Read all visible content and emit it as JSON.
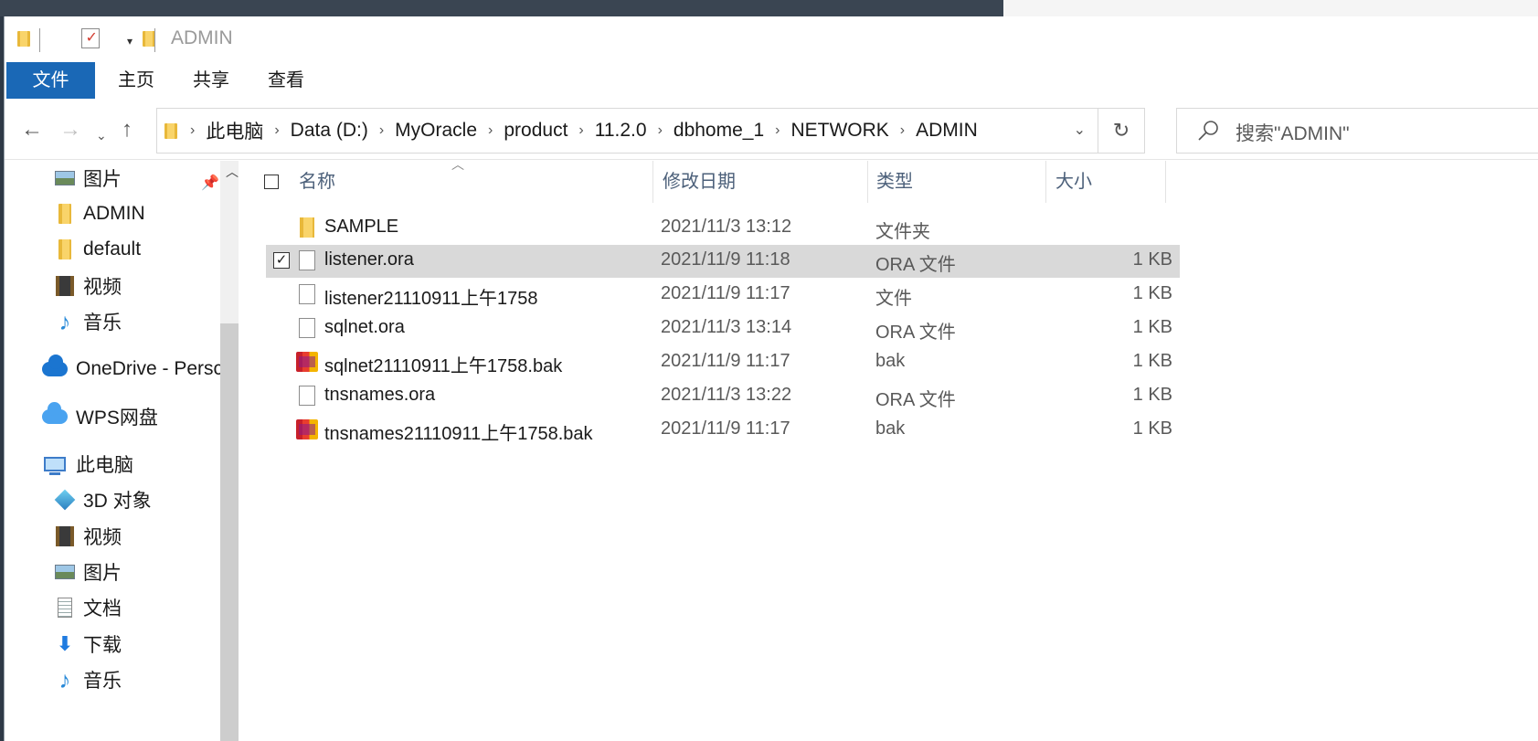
{
  "window": {
    "title": "ADMIN",
    "ribbon_tabs": [
      "文件",
      "主页",
      "共享",
      "查看"
    ]
  },
  "address": {
    "crumbs": [
      "此电脑",
      "Data (D:)",
      "MyOracle",
      "product",
      "11.2.0",
      "dbhome_1",
      "NETWORK",
      "ADMIN"
    ],
    "search_placeholder": "搜索\"ADMIN\""
  },
  "nav": {
    "items": [
      {
        "label": "图片",
        "icon": "picture-icon"
      },
      {
        "label": "ADMIN",
        "icon": "folder-icon"
      },
      {
        "label": "default",
        "icon": "folder-icon"
      },
      {
        "label": "视频",
        "icon": "video-icon"
      },
      {
        "label": "音乐",
        "icon": "music-icon"
      },
      {
        "label": "OneDrive - Persc",
        "icon": "onedrive-icon"
      },
      {
        "label": "WPS网盘",
        "icon": "wps-cloud-icon"
      },
      {
        "label": "此电脑",
        "icon": "this-pc-icon"
      },
      {
        "label": "3D 对象",
        "icon": "3d-objects-icon"
      },
      {
        "label": "视频",
        "icon": "video-icon"
      },
      {
        "label": "图片",
        "icon": "picture-icon"
      },
      {
        "label": "文档",
        "icon": "document-icon"
      },
      {
        "label": "下载",
        "icon": "download-icon"
      },
      {
        "label": "音乐",
        "icon": "music-icon"
      }
    ]
  },
  "filelist": {
    "columns": [
      "名称",
      "修改日期",
      "类型",
      "大小"
    ],
    "rows": [
      {
        "name": "SAMPLE",
        "date": "2021/11/3 13:12",
        "type": "文件夹",
        "size": "",
        "icon": "folder-icon",
        "selected": false
      },
      {
        "name": "listener.ora",
        "date": "2021/11/9 11:18",
        "type": "ORA 文件",
        "size": "1 KB",
        "icon": "file-icon",
        "selected": true
      },
      {
        "name": "listener21110911上午1758",
        "date": "2021/11/9 11:17",
        "type": "文件",
        "size": "1 KB",
        "icon": "file-icon",
        "selected": false
      },
      {
        "name": "sqlnet.ora",
        "date": "2021/11/3 13:14",
        "type": "ORA 文件",
        "size": "1 KB",
        "icon": "file-icon",
        "selected": false
      },
      {
        "name": "sqlnet21110911上午1758.bak",
        "date": "2021/11/9 11:17",
        "type": "bak",
        "size": "1 KB",
        "icon": "bak-archive-icon",
        "selected": false
      },
      {
        "name": "tnsnames.ora",
        "date": "2021/11/3 13:22",
        "type": "ORA 文件",
        "size": "1 KB",
        "icon": "file-icon",
        "selected": false
      },
      {
        "name": "tnsnames21110911上午1758.bak",
        "date": "2021/11/9 11:17",
        "type": "bak",
        "size": "1 KB",
        "icon": "bak-archive-icon",
        "selected": false
      }
    ]
  },
  "colors": {
    "file_tab_bg": "#1a68b6",
    "selection_bg": "#d9d9d9",
    "header_text": "#4c607a"
  }
}
